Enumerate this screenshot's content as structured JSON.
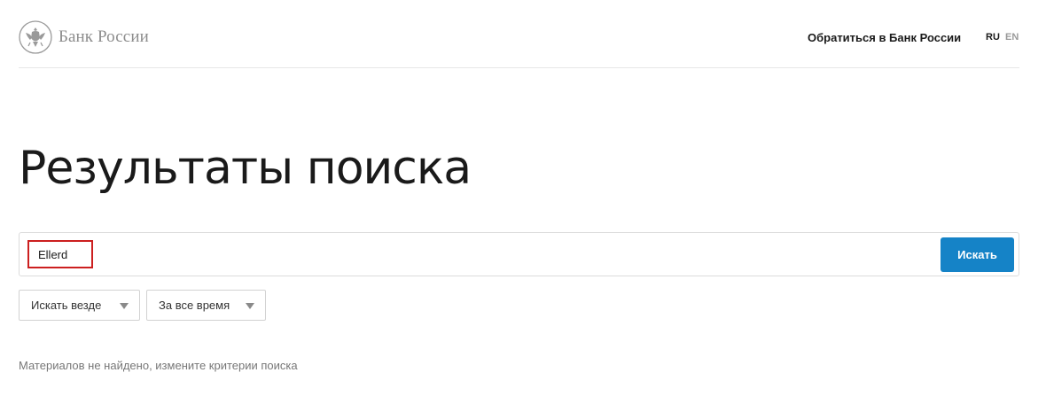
{
  "header": {
    "logo_text": "Банк России",
    "contact_link": "Обратиться в Банк России",
    "languages": [
      {
        "code": "RU",
        "active": true
      },
      {
        "code": "EN",
        "active": false
      }
    ]
  },
  "main": {
    "title": "Результаты поиска",
    "search": {
      "value": "Ellerd",
      "button_label": "Искать"
    },
    "filters": {
      "scope": "Искать везде",
      "period": "За все время"
    },
    "empty_message": "Материалов не найдено, измените критерии поиска"
  },
  "colors": {
    "accent": "#1583c7",
    "highlight": "#cc1f1f",
    "muted_text": "#8c8c8c"
  },
  "icons": [
    "bank-emblem-icon",
    "chevron-down-icon"
  ]
}
